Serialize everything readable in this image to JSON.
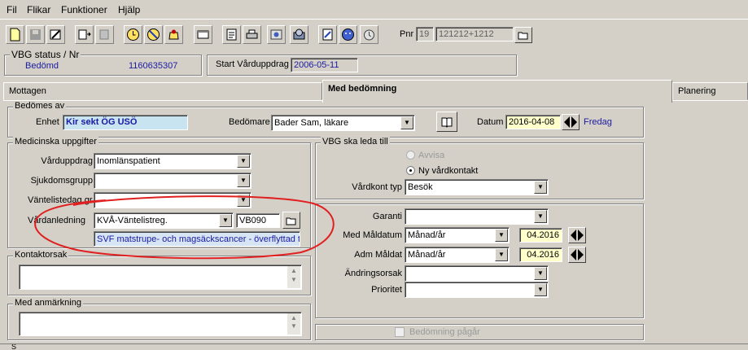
{
  "menu": [
    "Fil",
    "Flikar",
    "Funktioner",
    "Hjälp"
  ],
  "toolbar": {
    "icons": [
      "new-document-icon",
      "save-icon",
      "edit-icon",
      "print-preview-icon",
      "export-icon",
      "clock-icon",
      "clock-refresh-icon",
      "alarm-icon",
      "window-icon",
      "note-icon",
      "printer-icon",
      "web-icon",
      "phone-icon",
      "report-icon",
      "person-icon",
      "timer-icon"
    ],
    "pnr_label": "Pnr",
    "pnr_prefix": "19",
    "pnr_value": "121212+1212"
  },
  "status": {
    "title": "VBG status / Nr",
    "status_value": "Bedömd",
    "number": "1160635307",
    "start_label": "Start Vårduppdrag",
    "start_value": "2006-05-11"
  },
  "tabs": [
    "Mottagen",
    "Med bedömning",
    "Planering"
  ],
  "bedomes": {
    "title": "Bedömes av",
    "enhet_label": "Enhet",
    "enhet_value": "Kir sekt ÖG USÖ",
    "bedomare_label": "Bedömare",
    "bedomare_value": "Bader Sam, läkare",
    "datum_label": "Datum",
    "datum_value": "2016-04-08",
    "weekday": "Fredag"
  },
  "medicinska": {
    "title": "Medicinska uppgifter",
    "vardupp_label": "Vårduppdrag",
    "vardupp_value": "Inomlänspatient",
    "sjukdom_label": "Sjukdomsgrupp",
    "sjukdom_value": "",
    "vantelist_label": "Väntelistedag gr",
    "vantelist_value": "",
    "vardanl_label": "Vårdanledning",
    "vardanl_value": "KVÅ-Väntelistreg.",
    "vardanl_code": "VB090",
    "vardanl_desc": "SVF matstrupe- och magsäckscancer - överflyttad till"
  },
  "kontakt": {
    "title": "Kontaktorsak"
  },
  "anmarkning": {
    "title": "Med anmärkning"
  },
  "vbg": {
    "title": "VBG ska leda till",
    "opt_avvisa": "Avvisa",
    "opt_ny": "Ny vårdkontakt",
    "vardkont_label": "Vårdkont typ",
    "vardkont_value": "Besök"
  },
  "garanti": {
    "garanti_label": "Garanti",
    "garanti_value": "",
    "med_label": "Med Måldatum",
    "med_unit": "Månad/år",
    "med_value": "04.2016",
    "adm_label": "Adm Måldat",
    "adm_unit": "Månad/år",
    "adm_value": "04.2016",
    "andring_label": "Ändringsorsak",
    "andring_value": "",
    "prioritet_label": "Prioritet",
    "prioritet_value": ""
  },
  "bedomning_pagar": "Bedömning pågår",
  "bottom_fragment": "S"
}
